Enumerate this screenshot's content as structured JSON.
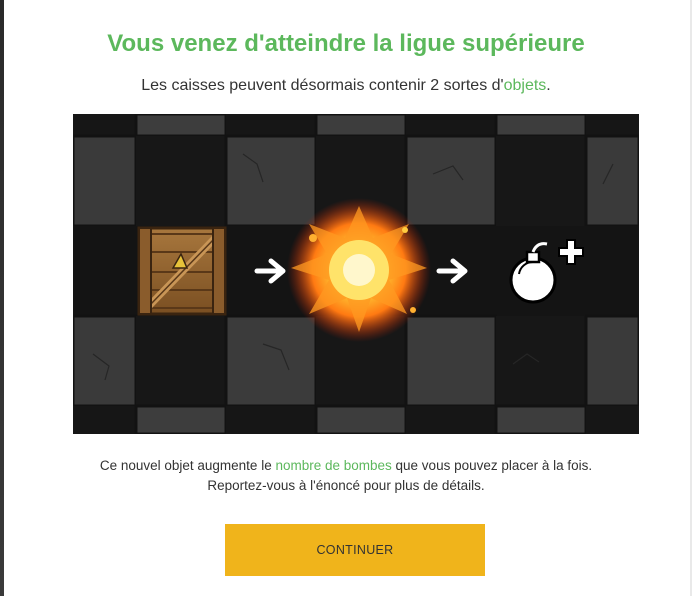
{
  "header": {
    "title": "Vous venez d'atteindre la ligue supérieure",
    "subtitle_prefix": "Les caisses peuvent désormais contenir 2 sortes d'",
    "subtitle_link": "objets",
    "subtitle_suffix": "."
  },
  "illustration": {
    "items": [
      "crate-icon",
      "arrow-right-icon",
      "explosion-icon",
      "arrow-right-icon",
      "bomb-plus-icon"
    ],
    "colors": {
      "dark_tile": "#141414",
      "stone_tile": "#3a3a3a",
      "crate": "#9a6a35",
      "fire": "#ff8a1a",
      "arrow": "#ffffff"
    }
  },
  "description": {
    "line1_prefix": "Ce nouvel objet augmente le ",
    "line1_link": "nombre de bombes",
    "line1_suffix": " que vous pouvez placer à la fois.",
    "line2": "Reportez-vous à l'énoncé pour plus de détails."
  },
  "actions": {
    "continue_label": "CONTINUER"
  },
  "colors": {
    "accent_green": "#5cb85c",
    "button_yellow": "#f0b41b"
  }
}
